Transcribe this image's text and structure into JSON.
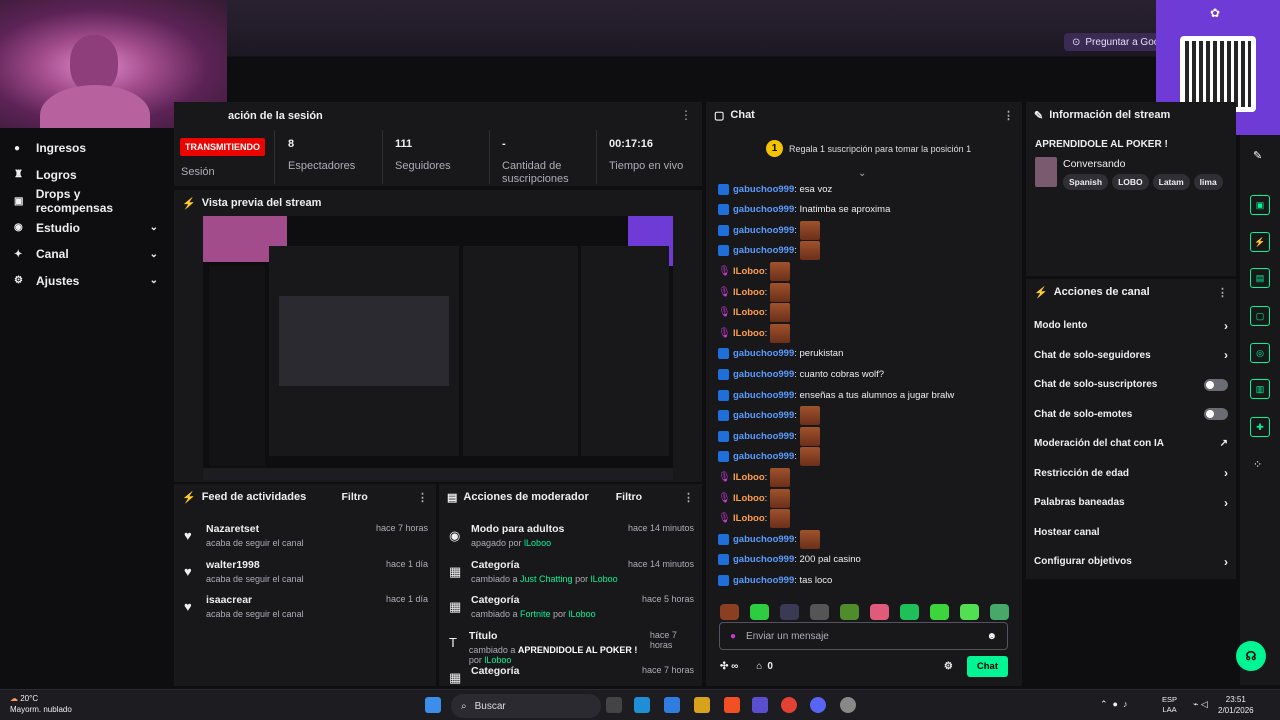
{
  "browser": {
    "ask_google": "Preguntar a Goog"
  },
  "sidebar": {
    "items": [
      {
        "label": "Ingresos",
        "icon": "money-icon",
        "chevron": false
      },
      {
        "label": "Logros",
        "icon": "trophy-icon",
        "chevron": false
      },
      {
        "label": "Drops y recompensas",
        "icon": "gift-icon",
        "chevron": false
      },
      {
        "label": "Estudio",
        "icon": "studio-icon",
        "chevron": true
      },
      {
        "label": "Canal",
        "icon": "channel-icon",
        "chevron": true
      },
      {
        "label": "Ajustes",
        "icon": "gear-icon",
        "chevron": true
      }
    ]
  },
  "session": {
    "title": "ación de la sesión",
    "live_badge": "TRANSMITIENDO",
    "live_label": "Sesión",
    "stats": [
      {
        "value": "8",
        "label": "Espectadores"
      },
      {
        "value": "111",
        "label": "Seguidores"
      },
      {
        "value": "-",
        "label": "Cantidad de suscripciones"
      },
      {
        "value": "00:17:16",
        "label": "Tiempo en vivo"
      }
    ]
  },
  "preview": {
    "title": "Vista previa del stream"
  },
  "activity": {
    "title": "Feed de actividades",
    "filter": "Filtro",
    "items": [
      {
        "name": "Nazaretset",
        "sub": "acaba de seguir el canal",
        "time": "hace 7 horas"
      },
      {
        "name": "walter1998",
        "sub": "acaba de seguir el canal",
        "time": "hace 1 día"
      },
      {
        "name": "isaacrear",
        "sub": "acaba de seguir el canal",
        "time": "hace 1 día"
      }
    ]
  },
  "moderator": {
    "title": "Acciones de moderador",
    "filter": "Filtro",
    "items": [
      {
        "title": "Modo para adultos",
        "pre": "apagado por ",
        "hl": "",
        "mid": "",
        "by": "lLoboo",
        "time": "hace 14 minutos"
      },
      {
        "title": "Categoría",
        "pre": "cambiado a ",
        "hl": "Just Chatting",
        "mid": " por ",
        "by": "lLoboo",
        "time": "hace 14 minutos"
      },
      {
        "title": "Categoría",
        "pre": "cambiado a ",
        "hl": "Fortnite",
        "mid": " por ",
        "by": "lLoboo",
        "time": "hace 5 horas"
      },
      {
        "title": "Título",
        "pre": "cambiado a ",
        "hl": "APRENDIDOLE AL POKER !",
        "mid": " por ",
        "by": "lLoboo",
        "time": "hace 7 horas"
      },
      {
        "title": "Categoría",
        "pre": "",
        "hl": "",
        "mid": "",
        "by": "",
        "time": "hace 7 horas"
      }
    ]
  },
  "chat": {
    "title": "Chat",
    "pinned_rank": "1",
    "pinned": "Regala 1 suscripción para tomar la posición 1",
    "messages": [
      {
        "user": "gabuchoo999",
        "text": ": esa voz",
        "emotes": 0,
        "style": "u1"
      },
      {
        "user": "gabuchoo999",
        "text": ": Inatimba se aproxima",
        "emotes": 0,
        "style": "u1"
      },
      {
        "user": "gabuchoo999",
        "text": ":",
        "emotes": 1,
        "style": "u1"
      },
      {
        "user": "gabuchoo999",
        "text": ":",
        "emotes": 1,
        "style": "u1"
      },
      {
        "user": "lLoboo",
        "text": ":",
        "emotes": 1,
        "style": "u2"
      },
      {
        "user": "lLoboo",
        "text": ":",
        "emotes": 1,
        "style": "u2"
      },
      {
        "user": "lLoboo",
        "text": ":",
        "emotes": 1,
        "style": "u2"
      },
      {
        "user": "lLoboo",
        "text": ":",
        "emotes": 1,
        "style": "u2"
      },
      {
        "user": "gabuchoo999",
        "text": ": perukistan",
        "emotes": 0,
        "style": "u1"
      },
      {
        "user": "gabuchoo999",
        "text": ": cuanto cobras wolf?",
        "emotes": 0,
        "style": "u1"
      },
      {
        "user": "gabuchoo999",
        "text": ": enseñas a tus alumnos a jugar bralw",
        "emotes": 0,
        "style": "u1"
      },
      {
        "user": "gabuchoo999",
        "text": ":",
        "emotes": 1,
        "style": "u1"
      },
      {
        "user": "gabuchoo999",
        "text": ":",
        "emotes": 1,
        "style": "u1"
      },
      {
        "user": "gabuchoo999",
        "text": ":",
        "emotes": 1,
        "style": "u1"
      },
      {
        "user": "lLoboo",
        "text": ":",
        "emotes": 1,
        "style": "u2"
      },
      {
        "user": "lLoboo",
        "text": ":",
        "emotes": 1,
        "style": "u2"
      },
      {
        "user": "lLoboo",
        "text": ":",
        "emotes": 1,
        "style": "u2"
      },
      {
        "user": "gabuchoo999",
        "text": ":",
        "emotes": 1,
        "style": "u1"
      },
      {
        "user": "gabuchoo999",
        "text": ": 200 pal casino",
        "emotes": 0,
        "style": "u1"
      },
      {
        "user": "gabuchoo999",
        "text": ": tas loco",
        "emotes": 0,
        "style": "u1"
      }
    ],
    "input_placeholder": "Enviar un mensaje",
    "points": "0",
    "send_label": "Chat"
  },
  "stream_info": {
    "title": "Información del stream",
    "stream_title": "APRENDIDOLE AL POKER !",
    "category": "Conversando",
    "tags": [
      "Spanish",
      "LOBO",
      "Latam",
      "lima"
    ]
  },
  "channel_actions": {
    "title": "Acciones de canal",
    "items": [
      {
        "label": "Modo lento",
        "control": "arrow"
      },
      {
        "label": "Chat de solo-seguidores",
        "control": "arrow"
      },
      {
        "label": "Chat de solo-suscriptores",
        "control": "toggle"
      },
      {
        "label": "Chat de solo-emotes",
        "control": "toggle"
      },
      {
        "label": "Moderación del chat con IA",
        "control": "external"
      },
      {
        "label": "Restricción de edad",
        "control": "arrow"
      },
      {
        "label": "Palabras baneadas",
        "control": "arrow"
      },
      {
        "label": "Hostear canal",
        "control": "none"
      },
      {
        "label": "Configurar objetivos",
        "control": "arrow"
      }
    ]
  },
  "taskbar": {
    "weather_temp": "20°C",
    "weather_desc": "Mayorm. nublado",
    "search": "Buscar",
    "lang1": "ESP",
    "lang2": "LAA",
    "time": "23:51",
    "date": "2/01/2026"
  }
}
